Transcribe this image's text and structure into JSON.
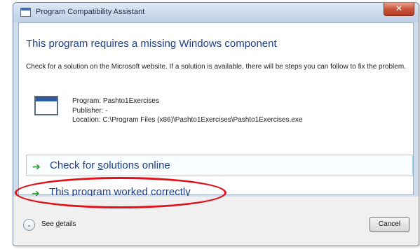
{
  "window": {
    "title": "Program Compatibility Assistant",
    "close_label": "✕"
  },
  "content": {
    "heading": "This program requires a missing Windows component",
    "description": "Check for a solution on the Microsoft website. If a solution is available, there will be steps you can follow to fix the problem.",
    "program_line": "Program: Pashto1Exercises",
    "publisher_line": "Publisher: -",
    "location_line": "Location: C:\\Program Files (x86)\\Pashto1Exercises\\Pashto1Exercises.exe"
  },
  "options": {
    "check_online": {
      "before": "Check for ",
      "accel": "s",
      "after": "olutions online",
      "arrow": "➔"
    },
    "worked_correctly": {
      "label": "This program worked correctly",
      "arrow": "➔"
    }
  },
  "footer": {
    "details_toggle": "⌄",
    "details_before": "See ",
    "details_accel": "d",
    "details_after": "etails",
    "cancel_label": "Cancel"
  },
  "colors": {
    "heading": "#1f3f8a",
    "arrow": "#2e9a2e",
    "highlight": "#e0121a"
  }
}
